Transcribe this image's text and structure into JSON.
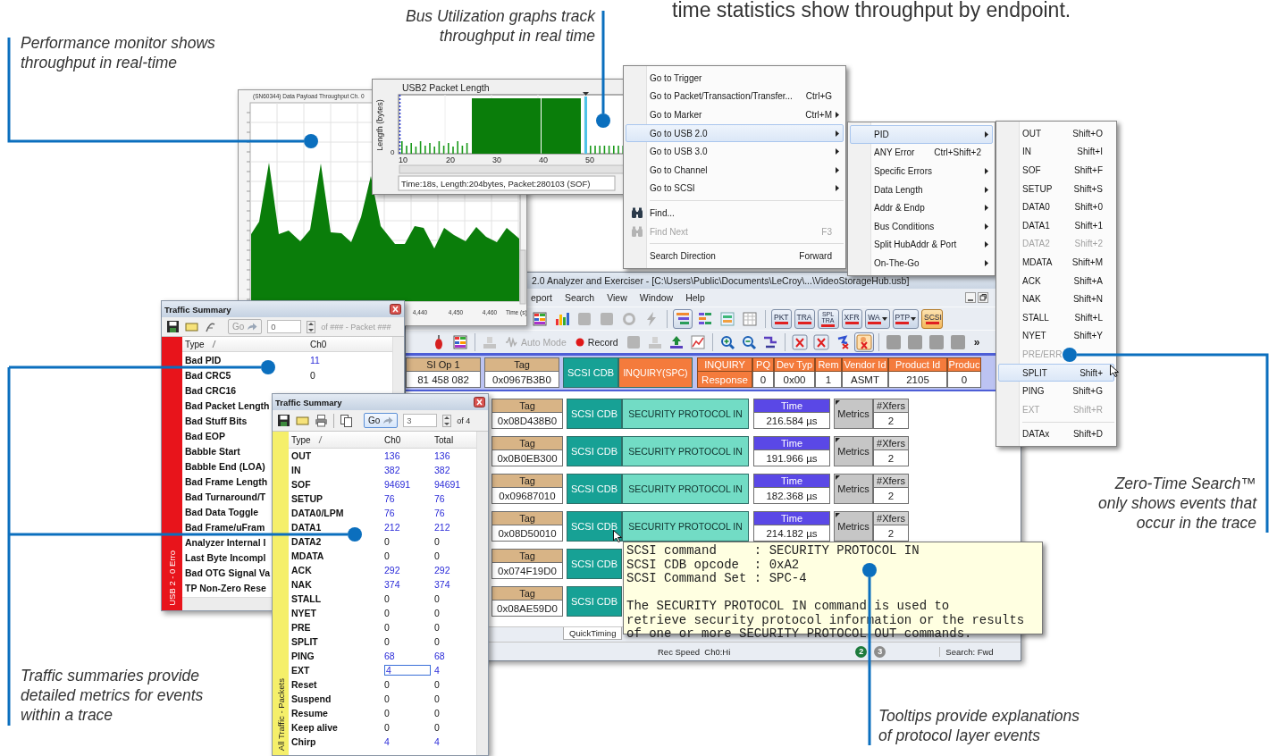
{
  "heading": "time statistics show throughput by endpoint.",
  "callouts": [
    {
      "text": "Performance monitor shows\nthroughput in real-time"
    },
    {
      "text": "Bus Utilization graphs track\nthroughput in real time"
    },
    {
      "text": "Traffic summaries provide\ndetailed metrics for events\nwithin a trace"
    },
    {
      "text": "Zero-Time Search™\nonly shows events that\noccur in the trace"
    },
    {
      "text": "Tooltips provide explanations\nof protocol layer events"
    }
  ],
  "performance_monitor": {
    "title": "(SN60344) Data Payload Throughput Ch. 0",
    "x_ticks": [
      "4,440",
      "4,450",
      "4,460"
    ],
    "x_label": "Time (s)"
  },
  "packet_length_graph": {
    "title": "USB2 Packet Length",
    "y_label": "Length (bytes)",
    "y_tick": "0",
    "x_ticks": [
      "10",
      "20",
      "30",
      "40",
      "50"
    ],
    "status": "Time:18s, Length:204bytes, Packet:280103 (SOF)"
  },
  "search_menu": {
    "items": [
      {
        "kind": "item",
        "label": "Go to Trigger",
        "submenu": false,
        "selected": false,
        "disabled": false
      },
      {
        "kind": "item",
        "label": "Go to Packet/Transaction/Transfer...",
        "shortcut": "Ctrl+G",
        "submenu": false,
        "selected": false,
        "disabled": false
      },
      {
        "kind": "item",
        "label": "Go to Marker",
        "shortcut": "Ctrl+M",
        "submenu": true,
        "selected": false,
        "disabled": false
      },
      {
        "kind": "item",
        "label": "Go to USB 2.0",
        "submenu": true,
        "selected": true,
        "disabled": false
      },
      {
        "kind": "item",
        "label": "Go to USB 3.0",
        "submenu": true,
        "selected": false,
        "disabled": false
      },
      {
        "kind": "item",
        "label": "Go to Channel",
        "submenu": true,
        "selected": false,
        "disabled": false
      },
      {
        "kind": "item",
        "label": "Go to SCSI",
        "submenu": true,
        "selected": false,
        "disabled": false
      },
      {
        "kind": "separator"
      },
      {
        "kind": "icon-item",
        "label": "Find...",
        "submenu": false,
        "selected": false,
        "disabled": false
      },
      {
        "kind": "icon-item",
        "label": "Find Next",
        "shortcut": "F3",
        "submenu": false,
        "selected": false,
        "disabled": true
      },
      {
        "kind": "separator"
      },
      {
        "kind": "item",
        "label": "Search Direction",
        "shortcut": "Forward",
        "submenu": false,
        "selected": false,
        "disabled": false
      }
    ]
  },
  "pid_submenu": {
    "items": [
      {
        "kind": "item",
        "label": "PID",
        "submenu": true,
        "selected": true,
        "disabled": false
      },
      {
        "kind": "item",
        "label": "ANY Error",
        "shortcut": "Ctrl+Shift+2",
        "submenu": false,
        "selected": false,
        "disabled": false
      },
      {
        "kind": "item",
        "label": "Specific Errors",
        "submenu": true,
        "selected": false,
        "disabled": false
      },
      {
        "kind": "item",
        "label": "Data Length",
        "submenu": true,
        "selected": false,
        "disabled": false
      },
      {
        "kind": "item",
        "label": "Addr & Endp",
        "submenu": true,
        "selected": false,
        "disabled": false
      },
      {
        "kind": "item",
        "label": "Bus Conditions",
        "submenu": true,
        "selected": false,
        "disabled": false
      },
      {
        "kind": "item",
        "label": "Split HubAddr & Port",
        "submenu": true,
        "selected": false,
        "disabled": false
      },
      {
        "kind": "item",
        "label": "On-The-Go",
        "submenu": true,
        "selected": false,
        "disabled": false
      }
    ]
  },
  "pid_menu": {
    "items": [
      {
        "kind": "item",
        "label": "OUT",
        "shortcut": "Shift+O",
        "submenu": false,
        "selected": false,
        "disabled": false
      },
      {
        "kind": "item",
        "label": "IN",
        "shortcut": "Shift+I",
        "submenu": false,
        "selected": false,
        "disabled": false
      },
      {
        "kind": "item",
        "label": "SOF",
        "shortcut": "Shift+F",
        "submenu": false,
        "selected": false,
        "disabled": false
      },
      {
        "kind": "item",
        "label": "SETUP",
        "shortcut": "Shift+S",
        "submenu": false,
        "selected": false,
        "disabled": false
      },
      {
        "kind": "item",
        "label": "DATA0",
        "shortcut": "Shift+0",
        "submenu": false,
        "selected": false,
        "disabled": false
      },
      {
        "kind": "item",
        "label": "DATA1",
        "shortcut": "Shift+1",
        "submenu": false,
        "selected": false,
        "disabled": false
      },
      {
        "kind": "item",
        "label": "DATA2",
        "shortcut": "Shift+2",
        "submenu": false,
        "selected": false,
        "disabled": true
      },
      {
        "kind": "item",
        "label": "MDATA",
        "shortcut": "Shift+M",
        "submenu": false,
        "selected": false,
        "disabled": false
      },
      {
        "kind": "item",
        "label": "ACK",
        "shortcut": "Shift+A",
        "submenu": false,
        "selected": false,
        "disabled": false
      },
      {
        "kind": "item",
        "label": "NAK",
        "shortcut": "Shift+N",
        "submenu": false,
        "selected": false,
        "disabled": false
      },
      {
        "kind": "item",
        "label": "STALL",
        "shortcut": "Shift+L",
        "submenu": false,
        "selected": false,
        "disabled": false
      },
      {
        "kind": "item",
        "label": "NYET",
        "shortcut": "Shift+Y",
        "submenu": false,
        "selected": false,
        "disabled": false
      },
      {
        "kind": "item",
        "label": "PRE/ERR",
        "submenu": false,
        "selected": false,
        "disabled": true
      },
      {
        "kind": "item",
        "label": "SPLIT",
        "shortcut": "Shift+",
        "submenu": false,
        "selected": true,
        "disabled": false
      },
      {
        "kind": "item",
        "label": "PING",
        "shortcut": "Shift+G",
        "submenu": false,
        "selected": false,
        "disabled": false
      },
      {
        "kind": "item",
        "label": "EXT",
        "shortcut": "Shift+R",
        "submenu": false,
        "selected": false,
        "disabled": true
      },
      {
        "kind": "separator"
      },
      {
        "kind": "item",
        "label": "DATAx",
        "shortcut": "Shift+D",
        "submenu": false,
        "selected": false,
        "disabled": false
      }
    ]
  },
  "analyzer_window": {
    "title": "2.0 Analyzer and Exerciser - [C:\\Users\\Public\\Documents\\LeCroy\\...\\VideoStorageHub.usb]",
    "menu": [
      "eport",
      "Search",
      "View",
      "Window",
      "Help"
    ],
    "protocol_buttons": [
      {
        "label": "PKT",
        "dropdown": false,
        "selected": false
      },
      {
        "label": "TRA",
        "dropdown": false,
        "selected": false
      },
      {
        "label": "SPL TRA",
        "dropdown": false,
        "selected": false
      },
      {
        "label": "XFR",
        "dropdown": false,
        "selected": false
      },
      {
        "label": "WA",
        "dropdown": true,
        "selected": false
      },
      {
        "label": "PTP",
        "dropdown": true,
        "selected": false
      },
      {
        "label": "SCSI",
        "dropdown": false,
        "selected": true
      }
    ],
    "mode_buttons": [
      {
        "kind": "auto",
        "label": "Auto Mode",
        "disabled": true
      },
      {
        "kind": "record",
        "label": "Record",
        "disabled": false
      }
    ],
    "overflow": "»",
    "trace_rows": [
      {
        "kind": "banded",
        "cells": [
          {
            "kind": "tag",
            "header": "SI Op 1",
            "value": "81 458 082"
          },
          {
            "kind": "tag",
            "header": "Tag",
            "value": "0x0967B3B0"
          },
          {
            "kind": "cdb",
            "label": "SCSI CDB"
          },
          {
            "kind": "command",
            "label": "INQUIRY(SPC)",
            "color": "#f47b3c"
          },
          {
            "kind": "response",
            "fields": [
              {
                "kind": "name",
                "header": "INQUIRY",
                "value": "Response"
              },
              {
                "kind": "value",
                "header": "PQ",
                "value": "0"
              },
              {
                "kind": "value",
                "header": "Dev Typ",
                "value": "0x00"
              },
              {
                "kind": "value",
                "header": "Rem",
                "value": "1"
              },
              {
                "kind": "value",
                "header": "Vendor Id",
                "value": "ASMT"
              },
              {
                "kind": "value",
                "header": "Product Id",
                "value": "2105"
              },
              {
                "kind": "value",
                "header": "Produc",
                "value": "0"
              }
            ]
          }
        ]
      },
      {
        "kind": "plain",
        "cells": [
          {
            "kind": "tag",
            "header": "Tag",
            "value": "0x08D438B0"
          },
          {
            "kind": "cdb",
            "label": "SCSI CDB"
          },
          {
            "kind": "command",
            "label": "SECURITY PROTOCOL IN",
            "color": "#72dcc5"
          },
          {
            "kind": "time",
            "header": "Time",
            "value": "216.584 µs"
          },
          {
            "kind": "metrics",
            "label": "Metrics",
            "header": "#Xfers",
            "value": "2"
          }
        ]
      },
      {
        "kind": "plain",
        "cells": [
          {
            "kind": "tag",
            "header": "Tag",
            "value": "0x0B0EB300"
          },
          {
            "kind": "cdb",
            "label": "SCSI CDB"
          },
          {
            "kind": "command",
            "label": "SECURITY PROTOCOL IN",
            "color": "#72dcc5"
          },
          {
            "kind": "time",
            "header": "Time",
            "value": "191.966 µs"
          },
          {
            "kind": "metrics",
            "label": "Metrics",
            "header": "#Xfers",
            "value": "2"
          }
        ]
      },
      {
        "kind": "plain",
        "cells": [
          {
            "kind": "tag",
            "header": "Tag",
            "value": "0x09687010"
          },
          {
            "kind": "cdb",
            "label": "SCSI CDB"
          },
          {
            "kind": "command",
            "label": "SECURITY PROTOCOL IN",
            "color": "#72dcc5"
          },
          {
            "kind": "time",
            "header": "Time",
            "value": "182.368 µs"
          },
          {
            "kind": "metrics",
            "label": "Metrics",
            "header": "#Xfers",
            "value": "2"
          }
        ]
      },
      {
        "kind": "plain",
        "cells": [
          {
            "kind": "tag",
            "header": "Tag",
            "value": "0x08D50010"
          },
          {
            "kind": "cdb",
            "label": "SCSI CDB"
          },
          {
            "kind": "command",
            "label": "SECURITY PROTOCOL IN",
            "color": "#72dcc5"
          },
          {
            "kind": "time",
            "header": "Time",
            "value": "214.182 µs"
          },
          {
            "kind": "metrics",
            "label": "Metrics",
            "header": "#Xfers",
            "value": "2"
          }
        ]
      },
      {
        "kind": "plain",
        "cells": [
          {
            "kind": "tag",
            "header": "Tag",
            "value": "0x074F19D0"
          },
          {
            "kind": "cdb",
            "label": "SCSI CDB"
          }
        ]
      },
      {
        "kind": "plain",
        "cells": [
          {
            "kind": "tag",
            "header": "Tag",
            "value": "0x08AE59D0"
          },
          {
            "kind": "cdb",
            "label": "SCSI CDB"
          }
        ]
      }
    ],
    "bottom_tab": "QuickTiming",
    "status": {
      "speed": "Rec Speed  Ch0:Hi",
      "indicators": [
        {
          "label": "2",
          "color": "#1d7a3c"
        },
        {
          "label": "3",
          "color": "#8c8c8c"
        }
      ],
      "search": "Search: Fwd"
    }
  },
  "traffic_summaries": [
    {
      "title": "Traffic Summary",
      "color": "#e8141b",
      "side_label": "USB 2 - 0 Erro",
      "toolbar": {
        "go": "Go",
        "go_enabled": false,
        "packet": "0",
        "count": "of ### - Packet ###"
      },
      "columns": [
        "Type",
        "Ch0"
      ],
      "rows": [
        {
          "type": "Bad PID",
          "values": [
            "11"
          ],
          "linked": true,
          "selected": false
        },
        {
          "type": "Bad CRC5",
          "values": [
            "0"
          ],
          "linked": false,
          "selected": false
        },
        {
          "type": "Bad CRC16",
          "values": []
        },
        {
          "type": "Bad Packet Length",
          "values": []
        },
        {
          "type": "Bad Stuff Bits",
          "values": []
        },
        {
          "type": "Bad EOP",
          "values": []
        },
        {
          "type": "Babble Start",
          "values": []
        },
        {
          "type": "Babble End (LOA)",
          "values": []
        },
        {
          "type": "Bad Frame Length",
          "values": []
        },
        {
          "type": "Bad Turnaround/T",
          "values": []
        },
        {
          "type": "Bad Data Toggle",
          "values": []
        },
        {
          "type": "Bad Frame/uFram",
          "values": []
        },
        {
          "type": "Analyzer Internal I",
          "values": []
        },
        {
          "type": "Last Byte Incompl",
          "values": []
        },
        {
          "type": "Bad OTG Signal Va",
          "values": []
        },
        {
          "type": "TP Non-Zero Rese",
          "values": []
        }
      ]
    },
    {
      "title": "Traffic Summary",
      "color": "#f5ef6a",
      "side_label": "All Traffic - Packets",
      "toolbar": {
        "go": "Go",
        "go_enabled": true,
        "packet": "3",
        "count": "of 4"
      },
      "columns": [
        "Type",
        "Ch0",
        "Total"
      ],
      "rows": [
        {
          "type": "OUT",
          "values": [
            "136",
            "136"
          ],
          "linked": true,
          "selected": false
        },
        {
          "type": "IN",
          "values": [
            "382",
            "382"
          ],
          "linked": true,
          "selected": false
        },
        {
          "type": "SOF",
          "values": [
            "94691",
            "94691"
          ],
          "linked": true,
          "selected": false
        },
        {
          "type": "SETUP",
          "values": [
            "76",
            "76"
          ],
          "linked": true,
          "selected": false
        },
        {
          "type": "DATA0/LPM",
          "values": [
            "76",
            "76"
          ],
          "linked": true,
          "selected": false
        },
        {
          "type": "DATA1",
          "values": [
            "212",
            "212"
          ],
          "linked": true,
          "selected": false
        },
        {
          "type": "DATA2",
          "values": [
            "0",
            "0"
          ],
          "linked": false,
          "selected": false
        },
        {
          "type": "MDATA",
          "values": [
            "0",
            "0"
          ],
          "linked": false,
          "selected": false
        },
        {
          "type": "ACK",
          "values": [
            "292",
            "292"
          ],
          "linked": true,
          "selected": false
        },
        {
          "type": "NAK",
          "values": [
            "374",
            "374"
          ],
          "linked": true,
          "selected": false
        },
        {
          "type": "STALL",
          "values": [
            "0",
            "0"
          ],
          "linked": false,
          "selected": false
        },
        {
          "type": "NYET",
          "values": [
            "0",
            "0"
          ],
          "linked": false,
          "selected": false
        },
        {
          "type": "PRE",
          "values": [
            "0",
            "0"
          ],
          "linked": false,
          "selected": false
        },
        {
          "type": "SPLIT",
          "values": [
            "0",
            "0"
          ],
          "linked": false,
          "selected": false
        },
        {
          "type": "PING",
          "values": [
            "68",
            "68"
          ],
          "linked": true,
          "selected": false
        },
        {
          "type": "EXT",
          "values": [
            "4",
            "4"
          ],
          "linked": true,
          "selected": true
        },
        {
          "type": "Reset",
          "values": [
            "0",
            "0"
          ],
          "linked": false,
          "selected": false
        },
        {
          "type": "Suspend",
          "values": [
            "0",
            "0"
          ],
          "linked": false,
          "selected": false
        },
        {
          "type": "Resume",
          "values": [
            "0",
            "0"
          ],
          "linked": false,
          "selected": false
        },
        {
          "type": "Keep alive",
          "values": [
            "0",
            "0"
          ],
          "linked": false,
          "selected": false
        },
        {
          "type": "Chirp",
          "values": [
            "4",
            "4"
          ],
          "linked": true,
          "selected": false
        }
      ]
    }
  ],
  "tooltip": {
    "lines": [
      "SCSI command     : SECURITY PROTOCOL IN",
      "SCSI CDB opcode  : 0xA2",
      "SCSI Command Set : SPC-4"
    ],
    "description": "The SECURITY PROTOCOL IN command is used to\nretrieve security protocol information or the results\nof one or more SECURITY PROTOCOL OUT commands."
  }
}
